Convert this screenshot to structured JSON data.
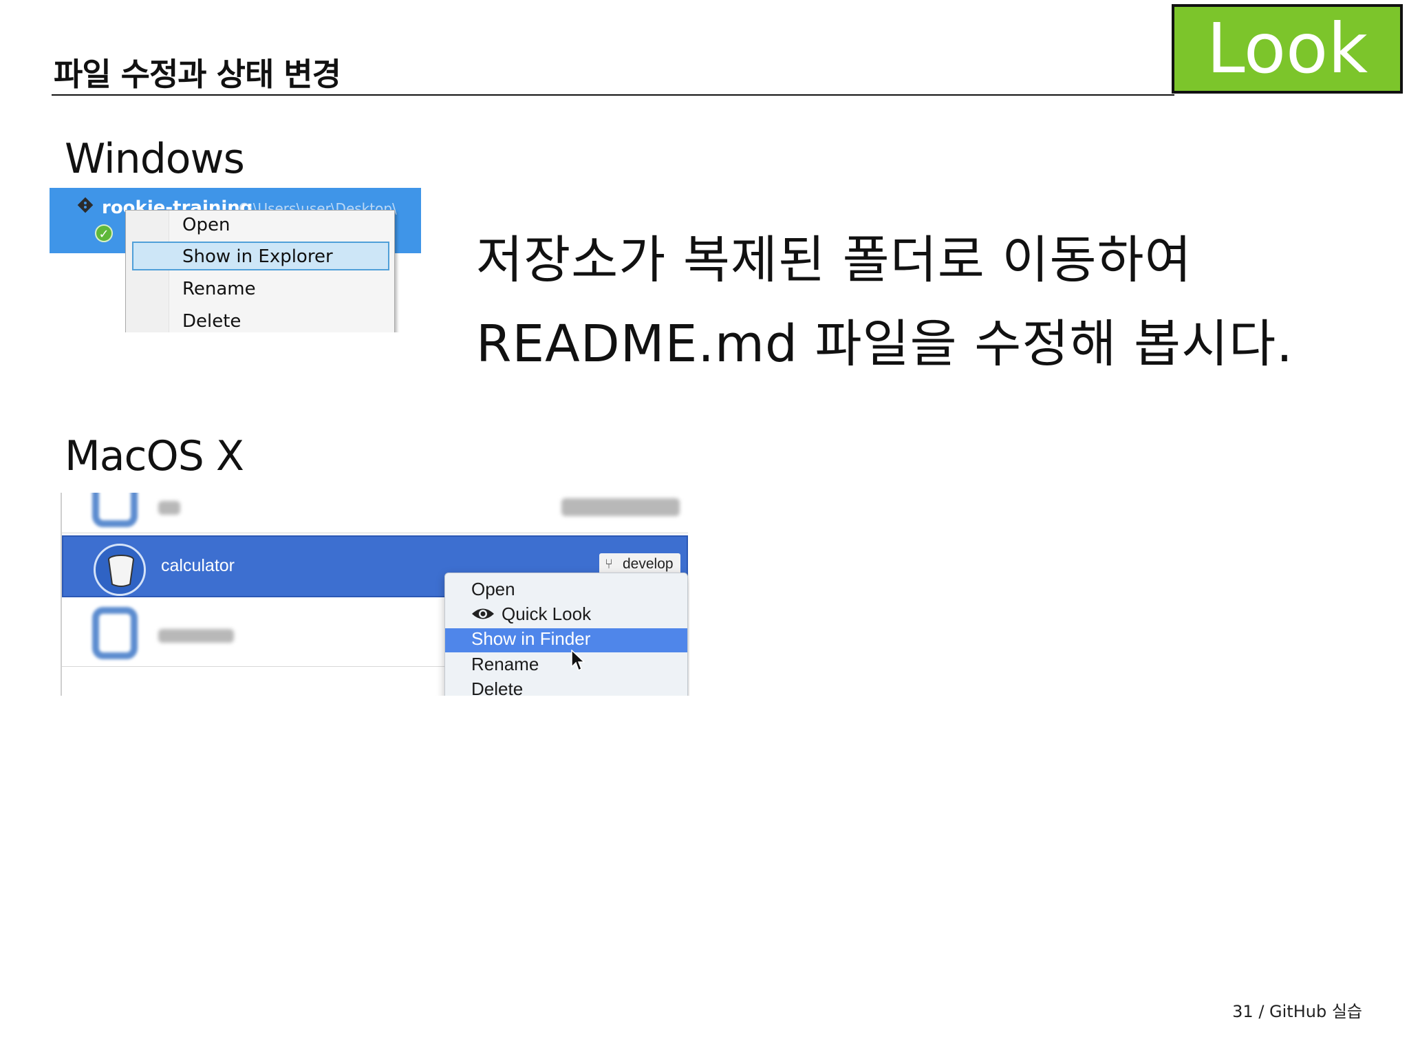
{
  "slide": {
    "title": "파일 수정과 상태 변경",
    "badge": "Look",
    "footer": "31 / GitHub 실습"
  },
  "sections": {
    "windows_label": "Windows",
    "mac_label": "MacOS X"
  },
  "instruction": {
    "line1": "저장소가  복제된  폴더로  이동하여",
    "line2": "README.md 파일을  수정해  봅시다."
  },
  "windows_shot": {
    "repo_name": "rookie-training",
    "repo_path": "C:\\Users\\user\\Desktop\\",
    "menu": [
      "Open",
      "Show in Explorer",
      "Rename",
      "Delete"
    ],
    "highlighted_index": 1
  },
  "mac_shot": {
    "repo_name": "calculator",
    "branch": "develop",
    "menu": {
      "open": "Open",
      "quick_look": "Quick Look",
      "show_in_finder": "Show in Finder",
      "rename": "Rename",
      "delete": "Delete"
    },
    "highlighted": "Show in Finder",
    "icons": [
      "eye-icon",
      "branch-icon",
      "bucket-icon",
      "cursor-icon"
    ]
  },
  "colors": {
    "badge_green": "#7cc52b",
    "windows_selection": "#3f95e8",
    "mac_selection": "#3d6fd0",
    "mac_menu_highlight": "#4f86ea"
  }
}
